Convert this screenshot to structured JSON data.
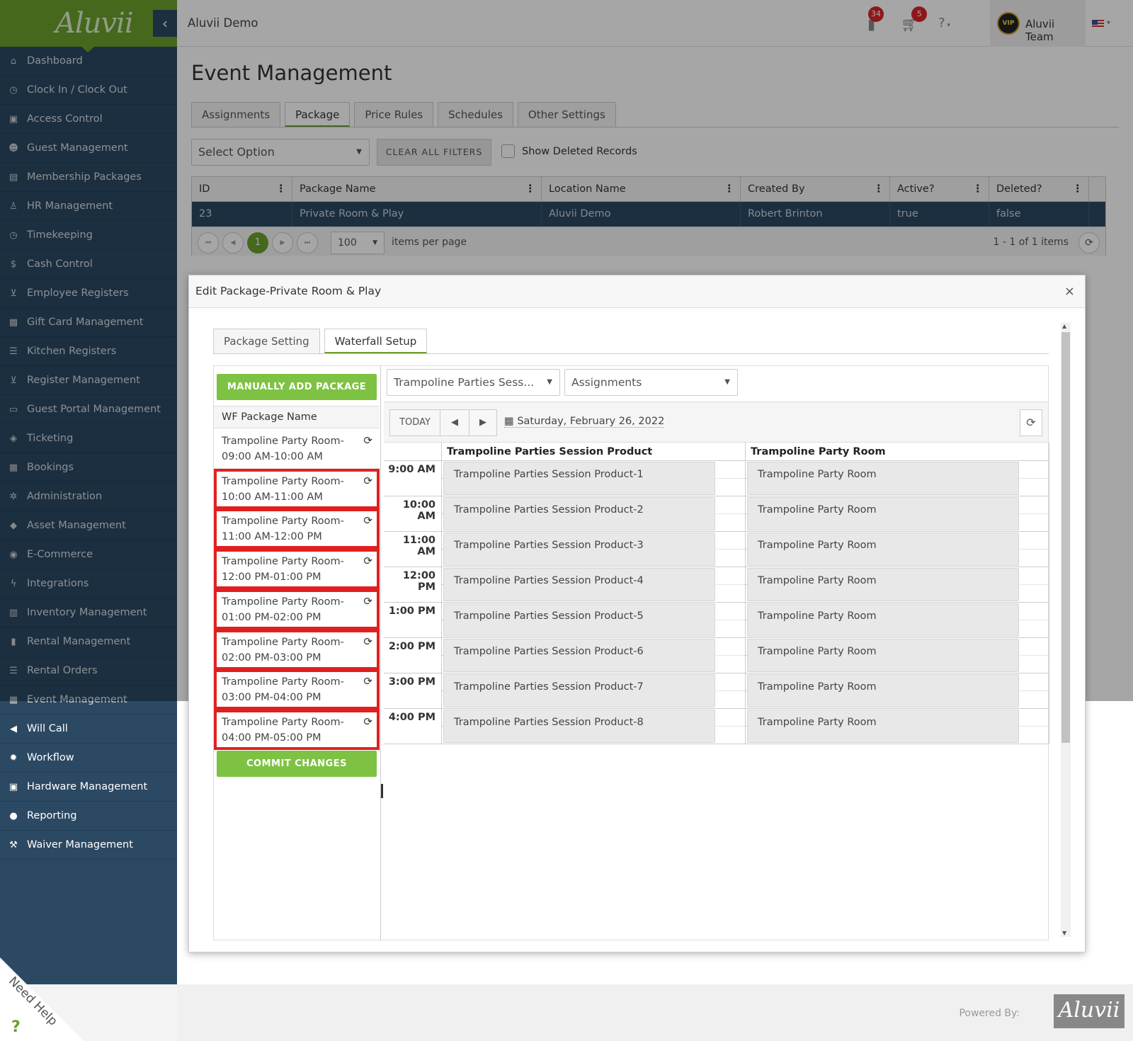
{
  "app": {
    "logo": "Aluvii",
    "location": "Aluvii Demo"
  },
  "topbar": {
    "cart_badge_1": "34",
    "cart_badge_2": "5",
    "user_name": "Aluvii Team"
  },
  "sidebar": {
    "items": [
      {
        "label": "Dashboard",
        "icon": "home-icon"
      },
      {
        "label": "Clock In / Clock Out",
        "icon": "clock-icon"
      },
      {
        "label": "Access Control",
        "icon": "lock-icon"
      },
      {
        "label": "Guest Management",
        "icon": "users-icon"
      },
      {
        "label": "Membership Packages",
        "icon": "card-icon"
      },
      {
        "label": "HR Management",
        "icon": "person-icon"
      },
      {
        "label": "Timekeeping",
        "icon": "clock-icon"
      },
      {
        "label": "Cash Control",
        "icon": "dollar-icon"
      },
      {
        "label": "Employee Registers",
        "icon": "cart-icon"
      },
      {
        "label": "Gift Card Management",
        "icon": "gift-icon"
      },
      {
        "label": "Kitchen Registers",
        "icon": "list-icon"
      },
      {
        "label": "Register Management",
        "icon": "cart-icon"
      },
      {
        "label": "Guest Portal Management",
        "icon": "laptop-icon"
      },
      {
        "label": "Ticketing",
        "icon": "ticket-icon"
      },
      {
        "label": "Bookings",
        "icon": "calendar-icon"
      },
      {
        "label": "Administration",
        "icon": "cogs-icon"
      },
      {
        "label": "Asset Management",
        "icon": "cubes-icon"
      },
      {
        "label": "E-Commerce",
        "icon": "globe-icon"
      },
      {
        "label": "Integrations",
        "icon": "bolt-icon"
      },
      {
        "label": "Inventory Management",
        "icon": "archive-icon"
      },
      {
        "label": "Rental Management",
        "icon": "clipboard-icon"
      },
      {
        "label": "Rental Orders",
        "icon": "list-icon"
      },
      {
        "label": "Event Management",
        "icon": "calendar-icon"
      },
      {
        "label": "Will Call",
        "icon": "bullhorn-icon"
      },
      {
        "label": "Workflow",
        "icon": "gear-icon"
      },
      {
        "label": "Hardware Management",
        "icon": "print-icon"
      },
      {
        "label": "Reporting",
        "icon": "lightbulb-icon"
      },
      {
        "label": "Waiver Management",
        "icon": "gavel-icon"
      }
    ]
  },
  "page": {
    "title": "Event Management",
    "tabs": [
      "Assignments",
      "Package",
      "Price Rules",
      "Schedules",
      "Other Settings"
    ],
    "active_tab": "Package",
    "filter_select": "Select Option",
    "clear_filters": "CLEAR ALL FILTERS",
    "show_deleted": "Show Deleted Records"
  },
  "grid": {
    "columns": [
      "ID",
      "Package Name",
      "Location Name",
      "Created By",
      "Active?",
      "Deleted?"
    ],
    "rows": [
      [
        "23",
        "Private Room & Play",
        "Aluvii Demo",
        "Robert Brinton",
        "true",
        "false"
      ]
    ],
    "current_page": "1",
    "page_size": "100",
    "per_page_label": "items per page",
    "count_label": "1 - 1 of 1 items"
  },
  "modal": {
    "title": "Edit Package-Private Room & Play",
    "close": "×",
    "tabs": [
      "Package Setting",
      "Waterfall Setup"
    ],
    "active_tab": "Waterfall Setup",
    "add_button": "MANUALLY ADD PACKAGE",
    "commit_button": "COMMIT CHANGES",
    "wf_header": "WF Package Name",
    "wf_items": [
      {
        "line1": "Trampoline Party Room-",
        "line2": "09:00 AM-10:00 AM",
        "highlighted": false
      },
      {
        "line1": "Trampoline Party Room-",
        "line2": "10:00 AM-11:00 AM",
        "highlighted": true
      },
      {
        "line1": "Trampoline Party Room-",
        "line2": "11:00 AM-12:00 PM",
        "highlighted": true
      },
      {
        "line1": "Trampoline Party Room-",
        "line2": "12:00 PM-01:00 PM",
        "highlighted": true
      },
      {
        "line1": "Trampoline Party Room-",
        "line2": "01:00 PM-02:00 PM",
        "highlighted": true
      },
      {
        "line1": "Trampoline Party Room-",
        "line2": "02:00 PM-03:00 PM",
        "highlighted": true
      },
      {
        "line1": "Trampoline Party Room-",
        "line2": "03:00 PM-04:00 PM",
        "highlighted": true
      },
      {
        "line1": "Trampoline Party Room-",
        "line2": "04:00 PM-05:00 PM",
        "highlighted": true
      }
    ],
    "resource_select": "Trampoline Parties Sess...",
    "view_select": "Assignments",
    "today_button": "TODAY",
    "date": "Saturday, February 26, 2022",
    "resources": [
      "Trampoline Parties Session Product",
      "Trampoline Party Room"
    ],
    "slots": [
      {
        "time": "9:00 AM",
        "a": "Trampoline Parties Session Product-1",
        "b": "Trampoline Party Room"
      },
      {
        "time": "10:00 AM",
        "a": "Trampoline Parties Session Product-2",
        "b": "Trampoline Party Room"
      },
      {
        "time": "11:00 AM",
        "a": "Trampoline Parties Session Product-3",
        "b": "Trampoline Party Room"
      },
      {
        "time": "12:00 PM",
        "a": "Trampoline Parties Session Product-4",
        "b": "Trampoline Party Room"
      },
      {
        "time": "1:00 PM",
        "a": "Trampoline Parties Session Product-5",
        "b": "Trampoline Party Room"
      },
      {
        "time": "2:00 PM",
        "a": "Trampoline Parties Session Product-6",
        "b": "Trampoline Party Room"
      },
      {
        "time": "3:00 PM",
        "a": "Trampoline Parties Session Product-7",
        "b": "Trampoline Party Room"
      },
      {
        "time": "4:00 PM",
        "a": "Trampoline Parties Session Product-8",
        "b": "Trampoline Party Room"
      }
    ]
  },
  "footer": {
    "powered_by": "Powered By:",
    "logo": "Aluvii",
    "help": "Need Help"
  },
  "colors": {
    "brand_green": "#6ba02b",
    "sidebar": "#2c4963",
    "highlight_red": "#e02020"
  }
}
